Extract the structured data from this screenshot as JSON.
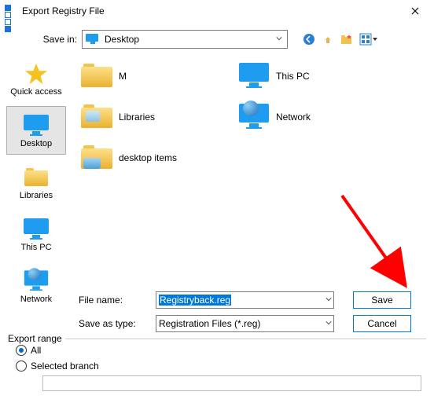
{
  "title": "Export Registry File",
  "savein": {
    "label": "Save in:",
    "value": "Desktop"
  },
  "sidebar": [
    {
      "label": "Quick access"
    },
    {
      "label": "Desktop"
    },
    {
      "label": "Libraries"
    },
    {
      "label": "This PC"
    },
    {
      "label": "Network"
    }
  ],
  "items": [
    {
      "label": "M"
    },
    {
      "label": "This PC"
    },
    {
      "label": "Libraries"
    },
    {
      "label": "Network"
    },
    {
      "label": "desktop items"
    }
  ],
  "filename": {
    "label": "File name:",
    "value": "Registryback.reg"
  },
  "filetype": {
    "label": "Save as type:",
    "value": "Registration Files (*.reg)"
  },
  "buttons": {
    "save": "Save",
    "cancel": "Cancel"
  },
  "export_range": {
    "legend": "Export range",
    "all": "All",
    "selected": "Selected branch"
  }
}
